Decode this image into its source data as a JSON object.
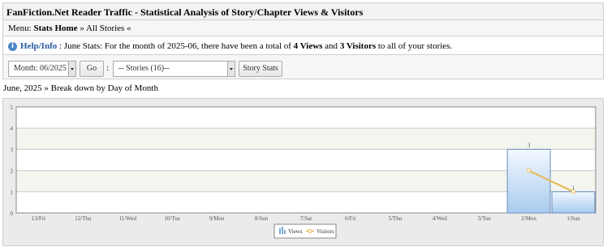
{
  "header": {
    "title": "FanFiction.Net Reader Traffic - Statistical Analysis of Story/Chapter Views & Visitors"
  },
  "menu": {
    "prefix": "Menu:",
    "stats_home": "Stats Home",
    "separator": "»",
    "all_stories": "All Stories",
    "suffix": "«"
  },
  "help": {
    "icon": "info-icon",
    "link": "Help/Info",
    "text_1": " : June Stats: For the month of 2025-06, there have been a total of ",
    "views_total": "4 Views",
    "text_2": " and ",
    "visitors_total": "3 Visitors",
    "text_3": " to all of your stories."
  },
  "controls": {
    "month_select": "Month: 06/2025",
    "go_button": "Go",
    "colon": ":",
    "stories_select": "-- Stories (16)--",
    "story_stats_button": "Story Stats"
  },
  "breakdown_label": "June, 2025 » Break down by Day of Month",
  "chart_data": {
    "type": "bar",
    "categories": [
      "13/Fri",
      "12/Thu",
      "11/Wed",
      "10/Tue",
      "9/Mon",
      "8/Sun",
      "7/Sat",
      "6/Fri",
      "5/Thu",
      "4/Wed",
      "3/Tue",
      "2/Mon",
      "1/Sun"
    ],
    "series": [
      {
        "name": "Views",
        "type": "bar",
        "values": [
          0,
          0,
          0,
          0,
          0,
          0,
          0,
          0,
          0,
          0,
          0,
          3,
          1
        ],
        "color": "#a9cbef"
      },
      {
        "name": "Visitors",
        "type": "line",
        "values": [
          null,
          null,
          null,
          null,
          null,
          null,
          null,
          null,
          null,
          null,
          null,
          2,
          1
        ],
        "color": "#e8b84a"
      }
    ],
    "ylim": [
      0,
      5
    ],
    "yticks": [
      0,
      1,
      2,
      3,
      4,
      5
    ],
    "grid": true,
    "legend": "bottom-center",
    "data_labels": {
      "2/Mon": "3",
      "1/Sun": "1"
    }
  }
}
